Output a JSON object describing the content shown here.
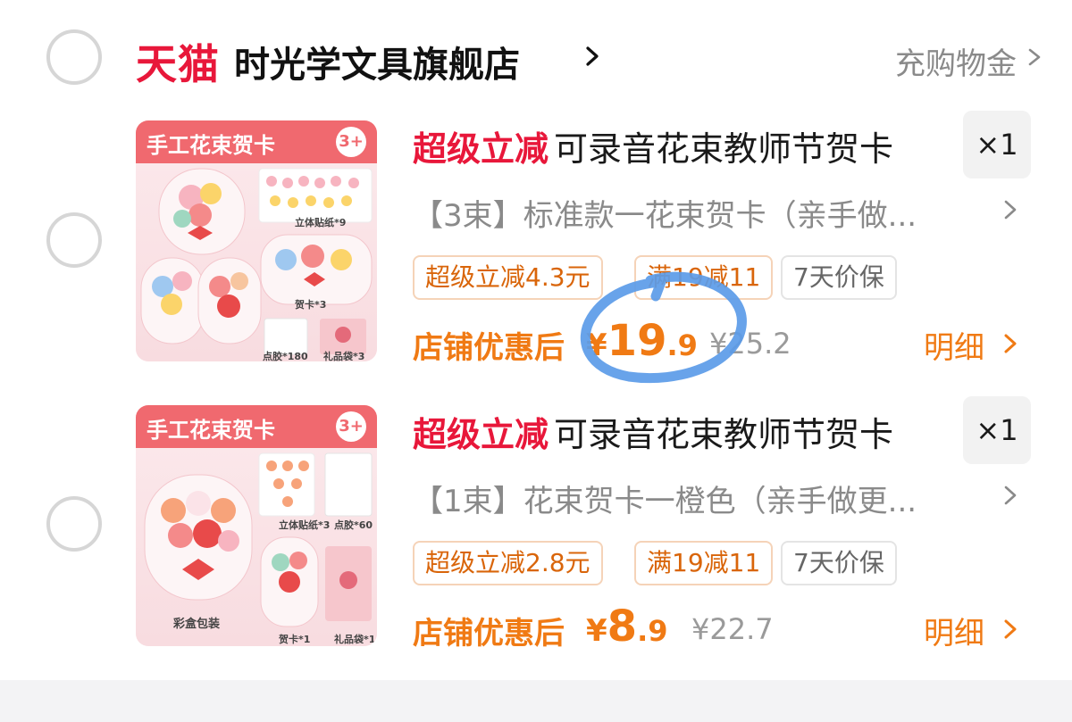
{
  "shop": {
    "platform_logo": "天猫",
    "name": "时光学文具旗舰店",
    "recharge_label": "充购物金"
  },
  "items": [
    {
      "thumb_title": "手工花束贺卡",
      "thumb_age": "3+",
      "thumb_labels": [
        "立体贴纸*9",
        "贺卡*3",
        "点胶*180",
        "礼品袋*3"
      ],
      "promo_tag": "超级立减",
      "title": "可录音花束教师节贺卡",
      "quantity": "×1",
      "sku": "【3束】标准款一花束贺卡（亲手做...",
      "badges": [
        "超级立减4.3元",
        "满19减11",
        "7天价保"
      ],
      "price_label": "店铺优惠后",
      "currency": "¥",
      "price_int": "19",
      "price_dec": ".9",
      "orig_price": "¥25.2",
      "detail_label": "明细"
    },
    {
      "thumb_title": "手工花束贺卡",
      "thumb_age": "3+",
      "thumb_labels": [
        "立体贴纸*3",
        "点胶*60",
        "彩盒包装",
        "贺卡*1",
        "礼品袋*1"
      ],
      "promo_tag": "超级立减",
      "title": "可录音花束教师节贺卡",
      "quantity": "×1",
      "sku": "【1束】花束贺卡一橙色（亲手做更...",
      "badges": [
        "超级立减2.8元",
        "满19减11",
        "7天价保"
      ],
      "price_label": "店铺优惠后",
      "currency": "¥",
      "price_int": "8",
      "price_dec": ".9",
      "orig_price": "¥22.7",
      "detail_label": "明细"
    }
  ],
  "colors": {
    "tmall_red": "#e8173a",
    "price_orange": "#f07a14",
    "annotation_blue": "#5b9be8"
  },
  "icons": [
    "chevron-right-icon",
    "radio-unchecked-icon"
  ]
}
